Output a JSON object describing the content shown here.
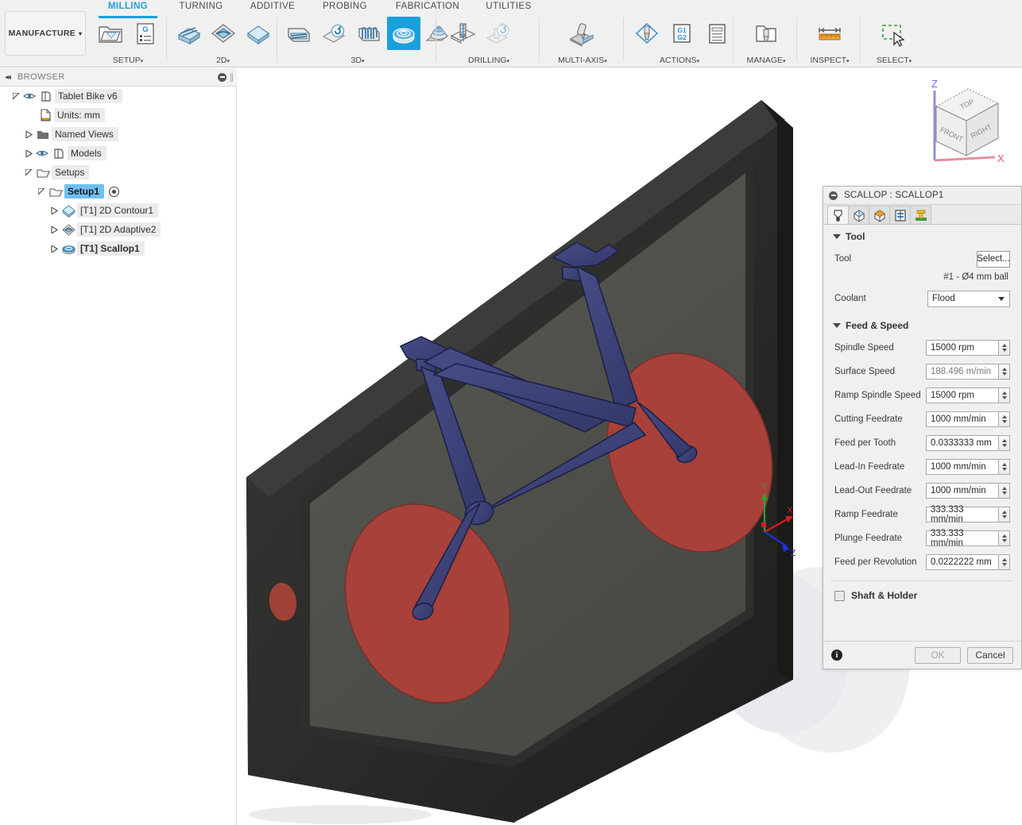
{
  "ribbon": {
    "workspace_button": {
      "label": "MANUFACTURE",
      "caret": "▾"
    },
    "tabs": [
      {
        "label": "MILLING",
        "active": true
      },
      {
        "label": "TURNING",
        "active": false
      },
      {
        "label": "ADDITIVE",
        "active": false
      },
      {
        "label": "PROBING",
        "active": false
      },
      {
        "label": "FABRICATION",
        "active": false
      },
      {
        "label": "UTILITIES",
        "active": false
      }
    ],
    "groups": [
      {
        "label": "SETUP",
        "caret": "▾"
      },
      {
        "label": "2D",
        "caret": "▾"
      },
      {
        "label": "3D",
        "caret": "▾"
      },
      {
        "label": "DRILLING",
        "caret": "▾"
      },
      {
        "label": "MULTI-AXIS",
        "caret": "▾"
      },
      {
        "label": "ACTIONS",
        "caret": "▾"
      },
      {
        "label": "MANAGE",
        "caret": "▾"
      },
      {
        "label": "INSPECT",
        "caret": "▾"
      },
      {
        "label": "SELECT",
        "caret": "▾"
      }
    ],
    "g_code_icon_text": {
      "line1": "G1",
      "line2": "G2"
    }
  },
  "browser": {
    "title": "BROWSER",
    "tree": [
      {
        "label": "Tablet Bike v6",
        "indent": 0,
        "arrow": "open",
        "eye": true,
        "icon": "body-icon",
        "style": "normal"
      },
      {
        "label": "Units: mm",
        "indent": 1,
        "arrow": "none",
        "eye": false,
        "icon": "document-icon",
        "style": "normal"
      },
      {
        "label": "Named Views",
        "indent": 1,
        "arrow": "closed",
        "eye": false,
        "icon": "folder-icon",
        "style": "normal"
      },
      {
        "label": "Models",
        "indent": 1,
        "arrow": "closed",
        "eye": true,
        "icon": "body-icon",
        "style": "normal"
      },
      {
        "label": "Setups",
        "indent": 1,
        "arrow": "open",
        "eye": false,
        "icon": "setup-folder-icon",
        "style": "normal"
      },
      {
        "label": "Setup1",
        "indent": 2,
        "arrow": "open",
        "eye": false,
        "icon": "setup-folder-icon",
        "style": "selected",
        "radio": true
      },
      {
        "label": "[T1] 2D Contour1",
        "indent": 3,
        "arrow": "closed",
        "eye": false,
        "icon": "contour-icon",
        "style": "normal"
      },
      {
        "label": "[T1] 2D Adaptive2",
        "indent": 3,
        "arrow": "closed",
        "eye": false,
        "icon": "adaptive-icon",
        "style": "normal"
      },
      {
        "label": "[T1] Scallop1",
        "indent": 3,
        "arrow": "closed",
        "eye": false,
        "icon": "scallop-icon",
        "style": "bold"
      }
    ]
  },
  "viewcube": {
    "top_face": "TOP",
    "front_face": "FRONT",
    "right_face": "RIGHT",
    "axis_z": "Z",
    "axis_x": "X"
  },
  "canvas": {
    "origin_triad": {
      "x": "X",
      "y": "Y",
      "z": "Z"
    },
    "colors": {
      "body_blue": "#3d4276",
      "toolpath_red": "#a8413a",
      "tablet_black": "#2a2a2a",
      "screen_gray": "#545450"
    }
  },
  "properties": {
    "title": "SCALLOP : SCALLOP1",
    "tabs": [
      {
        "name": "tool-tab",
        "active": true
      },
      {
        "name": "geometry-tab",
        "active": false
      },
      {
        "name": "heights-tab",
        "active": false
      },
      {
        "name": "passes-tab",
        "active": false
      },
      {
        "name": "linking-tab",
        "active": false
      }
    ],
    "tool_section": {
      "heading": "Tool",
      "tool_label": "Tool",
      "select_button": "Select...",
      "tool_description": "#1 - Ø4 mm ball",
      "coolant_label": "Coolant",
      "coolant_value": "Flood"
    },
    "feed_speed_section": {
      "heading": "Feed & Speed",
      "rows": [
        {
          "label": "Spindle Speed",
          "value": "15000 rpm",
          "readonly": false
        },
        {
          "label": "Surface Speed",
          "value": "188.496 m/min",
          "readonly": true
        },
        {
          "label": "Ramp Spindle Speed",
          "value": "15000 rpm",
          "readonly": false
        },
        {
          "label": "Cutting Feedrate",
          "value": "1000 mm/min",
          "readonly": false
        },
        {
          "label": "Feed per Tooth",
          "value": "0.0333333 mm",
          "readonly": false
        },
        {
          "label": "Lead-In Feedrate",
          "value": "1000 mm/min",
          "readonly": false
        },
        {
          "label": "Lead-Out Feedrate",
          "value": "1000 mm/min",
          "readonly": false
        },
        {
          "label": "Ramp Feedrate",
          "value": "333.333 mm/min",
          "readonly": false
        },
        {
          "label": "Plunge Feedrate",
          "value": "333.333 mm/min",
          "readonly": false
        },
        {
          "label": "Feed per Revolution",
          "value": "0.0222222 mm",
          "readonly": false
        }
      ]
    },
    "shaft_holder": {
      "label": "Shaft & Holder",
      "checked": false
    },
    "footer": {
      "info": "i",
      "ok": "OK",
      "ok_disabled": true,
      "cancel": "Cancel"
    }
  }
}
